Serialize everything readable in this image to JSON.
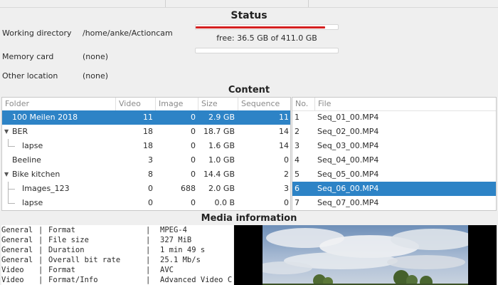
{
  "status": {
    "title": "Status",
    "working_directory_label": "Working directory",
    "working_directory_value": "/home/anke/Actioncam",
    "memory_card_label": "Memory card",
    "memory_card_value": "(none)",
    "other_location_label": "Other location",
    "other_location_value": "(none)",
    "disk_free_text": "free: 36.5 GB of 411.0 GB",
    "disk_used_fraction": 0.911,
    "bar_color": "#d42020"
  },
  "content": {
    "title": "Content",
    "folder_headers": [
      "Folder",
      "Video",
      "Image",
      "Size",
      "Sequence"
    ],
    "folders": [
      {
        "name": "100 Meilen 2018",
        "video": "11",
        "image": "0",
        "size": "2.9 GB",
        "sequence": "11"
      },
      {
        "name": "BER",
        "video": "18",
        "image": "0",
        "size": "18.7 GB",
        "sequence": "14"
      },
      {
        "name": "lapse",
        "video": "18",
        "image": "0",
        "size": "1.6 GB",
        "sequence": "14"
      },
      {
        "name": "Beeline",
        "video": "3",
        "image": "0",
        "size": "1.0 GB",
        "sequence": "0"
      },
      {
        "name": "Bike kitchen",
        "video": "8",
        "image": "0",
        "size": "14.4 GB",
        "sequence": "2"
      },
      {
        "name": "Images_123",
        "video": "0",
        "image": "688",
        "size": "2.0 GB",
        "sequence": "3"
      },
      {
        "name": "lapse",
        "video": "0",
        "image": "0",
        "size": "0.0 B",
        "sequence": "0"
      }
    ],
    "file_headers": [
      "No.",
      "File"
    ],
    "files": [
      {
        "no": "1",
        "file": "Seq_01_00.MP4"
      },
      {
        "no": "2",
        "file": "Seq_02_00.MP4"
      },
      {
        "no": "3",
        "file": "Seq_03_00.MP4"
      },
      {
        "no": "4",
        "file": "Seq_04_00.MP4"
      },
      {
        "no": "5",
        "file": "Seq_05_00.MP4"
      },
      {
        "no": "6",
        "file": "Seq_06_00.MP4"
      },
      {
        "no": "7",
        "file": "Seq_07_00.MP4"
      }
    ],
    "selection_color": "#2d83c6"
  },
  "media": {
    "title": "Media information",
    "rows": [
      {
        "section": "General",
        "key": "Format",
        "value": "MPEG-4"
      },
      {
        "section": "General",
        "key": "File size",
        "value": "327 MiB"
      },
      {
        "section": "General",
        "key": "Duration",
        "value": "1 min 49 s"
      },
      {
        "section": "General",
        "key": "Overall bit rate",
        "value": "25.1 Mb/s"
      },
      {
        "section": "Video",
        "key": "Format",
        "value": "AVC"
      },
      {
        "section": "Video",
        "key": "Format/Info",
        "value": "Advanced Video C"
      }
    ]
  }
}
